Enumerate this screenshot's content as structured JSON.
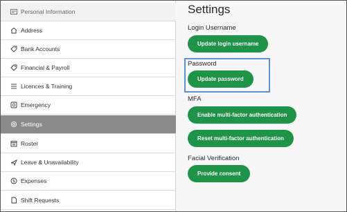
{
  "sidebar": {
    "items": [
      {
        "label": "Personal Information",
        "icon": "id-card-icon"
      },
      {
        "label": "Address",
        "icon": "home-icon"
      },
      {
        "label": "Bank Accounts",
        "icon": "tag-icon"
      },
      {
        "label": "Financial & Payroll",
        "icon": "tag-icon"
      },
      {
        "label": "Licences & Training",
        "icon": "list-icon"
      },
      {
        "label": "Emergency",
        "icon": "emergency-icon"
      },
      {
        "label": "Settings",
        "icon": "gear-icon"
      },
      {
        "label": "Roster",
        "icon": "calendar-icon"
      },
      {
        "label": "Leave & Unavailability",
        "icon": "plane-icon"
      },
      {
        "label": "Expenses",
        "icon": "dollar-icon"
      },
      {
        "label": "Shift Requests",
        "icon": "document-icon"
      }
    ],
    "active_index": 6
  },
  "main": {
    "title": "Settings",
    "sections": {
      "login_username": {
        "label": "Login Username",
        "button": "Update login username"
      },
      "password": {
        "label": "Password",
        "button": "Update password"
      },
      "mfa": {
        "label": "MFA",
        "enable_button": "Enable multi-factor authentication",
        "reset_button": "Reset multi-factor authentication"
      },
      "facial": {
        "label": "Facial Verification",
        "button": "Provide consent"
      }
    }
  },
  "colors": {
    "button_green": "#1f9448",
    "active_sidebar": "#8a8a8a",
    "highlight_border": "#5b8fd4"
  }
}
